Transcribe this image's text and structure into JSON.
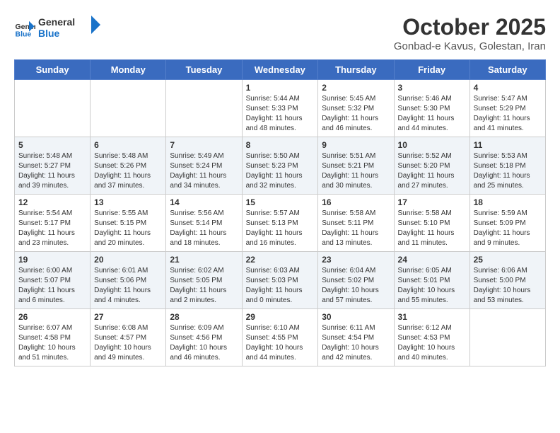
{
  "header": {
    "logo_line1": "General",
    "logo_line2": "Blue",
    "month_title": "October 2025",
    "subtitle": "Gonbad-e Kavus, Golestan, Iran"
  },
  "weekdays": [
    "Sunday",
    "Monday",
    "Tuesday",
    "Wednesday",
    "Thursday",
    "Friday",
    "Saturday"
  ],
  "weeks": [
    [
      {
        "day": "",
        "info": ""
      },
      {
        "day": "",
        "info": ""
      },
      {
        "day": "",
        "info": ""
      },
      {
        "day": "1",
        "info": "Sunrise: 5:44 AM\nSunset: 5:33 PM\nDaylight: 11 hours and 48 minutes."
      },
      {
        "day": "2",
        "info": "Sunrise: 5:45 AM\nSunset: 5:32 PM\nDaylight: 11 hours and 46 minutes."
      },
      {
        "day": "3",
        "info": "Sunrise: 5:46 AM\nSunset: 5:30 PM\nDaylight: 11 hours and 44 minutes."
      },
      {
        "day": "4",
        "info": "Sunrise: 5:47 AM\nSunset: 5:29 PM\nDaylight: 11 hours and 41 minutes."
      }
    ],
    [
      {
        "day": "5",
        "info": "Sunrise: 5:48 AM\nSunset: 5:27 PM\nDaylight: 11 hours and 39 minutes."
      },
      {
        "day": "6",
        "info": "Sunrise: 5:48 AM\nSunset: 5:26 PM\nDaylight: 11 hours and 37 minutes."
      },
      {
        "day": "7",
        "info": "Sunrise: 5:49 AM\nSunset: 5:24 PM\nDaylight: 11 hours and 34 minutes."
      },
      {
        "day": "8",
        "info": "Sunrise: 5:50 AM\nSunset: 5:23 PM\nDaylight: 11 hours and 32 minutes."
      },
      {
        "day": "9",
        "info": "Sunrise: 5:51 AM\nSunset: 5:21 PM\nDaylight: 11 hours and 30 minutes."
      },
      {
        "day": "10",
        "info": "Sunrise: 5:52 AM\nSunset: 5:20 PM\nDaylight: 11 hours and 27 minutes."
      },
      {
        "day": "11",
        "info": "Sunrise: 5:53 AM\nSunset: 5:18 PM\nDaylight: 11 hours and 25 minutes."
      }
    ],
    [
      {
        "day": "12",
        "info": "Sunrise: 5:54 AM\nSunset: 5:17 PM\nDaylight: 11 hours and 23 minutes."
      },
      {
        "day": "13",
        "info": "Sunrise: 5:55 AM\nSunset: 5:15 PM\nDaylight: 11 hours and 20 minutes."
      },
      {
        "day": "14",
        "info": "Sunrise: 5:56 AM\nSunset: 5:14 PM\nDaylight: 11 hours and 18 minutes."
      },
      {
        "day": "15",
        "info": "Sunrise: 5:57 AM\nSunset: 5:13 PM\nDaylight: 11 hours and 16 minutes."
      },
      {
        "day": "16",
        "info": "Sunrise: 5:58 AM\nSunset: 5:11 PM\nDaylight: 11 hours and 13 minutes."
      },
      {
        "day": "17",
        "info": "Sunrise: 5:58 AM\nSunset: 5:10 PM\nDaylight: 11 hours and 11 minutes."
      },
      {
        "day": "18",
        "info": "Sunrise: 5:59 AM\nSunset: 5:09 PM\nDaylight: 11 hours and 9 minutes."
      }
    ],
    [
      {
        "day": "19",
        "info": "Sunrise: 6:00 AM\nSunset: 5:07 PM\nDaylight: 11 hours and 6 minutes."
      },
      {
        "day": "20",
        "info": "Sunrise: 6:01 AM\nSunset: 5:06 PM\nDaylight: 11 hours and 4 minutes."
      },
      {
        "day": "21",
        "info": "Sunrise: 6:02 AM\nSunset: 5:05 PM\nDaylight: 11 hours and 2 minutes."
      },
      {
        "day": "22",
        "info": "Sunrise: 6:03 AM\nSunset: 5:03 PM\nDaylight: 11 hours and 0 minutes."
      },
      {
        "day": "23",
        "info": "Sunrise: 6:04 AM\nSunset: 5:02 PM\nDaylight: 10 hours and 57 minutes."
      },
      {
        "day": "24",
        "info": "Sunrise: 6:05 AM\nSunset: 5:01 PM\nDaylight: 10 hours and 55 minutes."
      },
      {
        "day": "25",
        "info": "Sunrise: 6:06 AM\nSunset: 5:00 PM\nDaylight: 10 hours and 53 minutes."
      }
    ],
    [
      {
        "day": "26",
        "info": "Sunrise: 6:07 AM\nSunset: 4:58 PM\nDaylight: 10 hours and 51 minutes."
      },
      {
        "day": "27",
        "info": "Sunrise: 6:08 AM\nSunset: 4:57 PM\nDaylight: 10 hours and 49 minutes."
      },
      {
        "day": "28",
        "info": "Sunrise: 6:09 AM\nSunset: 4:56 PM\nDaylight: 10 hours and 46 minutes."
      },
      {
        "day": "29",
        "info": "Sunrise: 6:10 AM\nSunset: 4:55 PM\nDaylight: 10 hours and 44 minutes."
      },
      {
        "day": "30",
        "info": "Sunrise: 6:11 AM\nSunset: 4:54 PM\nDaylight: 10 hours and 42 minutes."
      },
      {
        "day": "31",
        "info": "Sunrise: 6:12 AM\nSunset: 4:53 PM\nDaylight: 10 hours and 40 minutes."
      },
      {
        "day": "",
        "info": ""
      }
    ]
  ]
}
